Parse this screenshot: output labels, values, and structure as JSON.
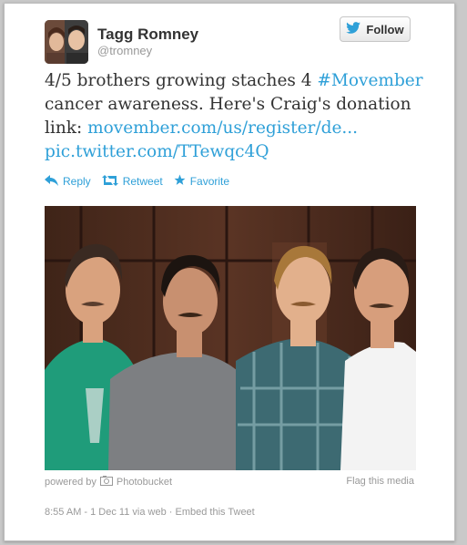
{
  "author": {
    "name": "Tagg Romney",
    "handle": "@tromney"
  },
  "follow_label": "Follow",
  "tweet": {
    "line1_text": "4/5 brothers growing staches 4 ",
    "hashtag": "#Movember",
    "line2_text": "cancer awareness. Here's Craig's donation",
    "line3_prefix": "link: ",
    "donation_link": "movember.com/us/register/de...",
    "pic_link": "pic.twitter.com/TTewqc4Q"
  },
  "actions": {
    "reply": "Reply",
    "retweet": "Retweet",
    "favorite": "Favorite"
  },
  "media": {
    "powered_by": "powered by",
    "provider": "Photobucket",
    "flag": "Flag this media"
  },
  "meta": {
    "timestamp": "8:55 AM - 1 Dec 11 via web",
    "separator": "·",
    "embed": "Embed this Tweet"
  },
  "colors": {
    "link": "#2fa0d8",
    "twitter_bird": "#2fa0d8"
  },
  "icons": [
    "twitter-bird-icon",
    "reply-icon",
    "retweet-icon",
    "star-icon",
    "photobucket-icon"
  ]
}
